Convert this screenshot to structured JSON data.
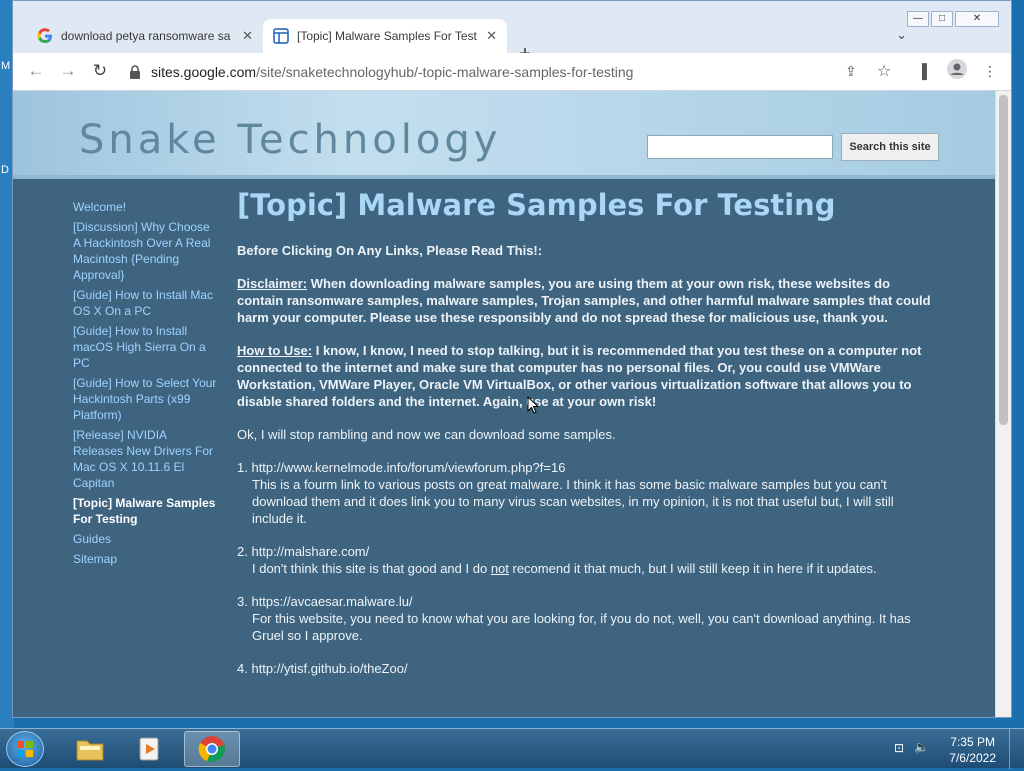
{
  "desktop": {
    "glyph1": "M",
    "glyph2": "D"
  },
  "browser": {
    "tabs": [
      {
        "title": "download petya ransomware sa",
        "favicon": "google-g-icon"
      },
      {
        "title": "[Topic] Malware Samples For Test",
        "favicon": "page-icon"
      }
    ],
    "new_tab": "+",
    "url_host": "sites.google.com",
    "url_path": "/site/snaketechnologyhub/-topic-malware-samples-for-testing",
    "window_controls": {
      "minimize": "—",
      "maximize": "□",
      "close": "✕"
    }
  },
  "site": {
    "title": "Snake Technology",
    "search_button": "Search this site",
    "search_value": "",
    "sidebar": [
      "Welcome!",
      "[Discussion] Why Choose A Hackintosh Over A Real Macintosh {Pending Approval}",
      "[Guide] How to Install Mac OS X On a PC",
      "[Guide] How to Install macOS High Sierra On a PC",
      "[Guide] How to Select Your Hackintosh Parts (x99 Platform)",
      "[Release] NVIDIA Releases New Drivers For Mac OS X 10.11.6 El Capitan",
      "[Topic] Malware Samples For Testing",
      "Guides",
      "Sitemap"
    ],
    "page": {
      "heading": "[Topic] Malware Samples For Testing",
      "intro": "Before Clicking On Any Links, Please Read This!:",
      "disclaimer_label": "Disclaimer:",
      "disclaimer_text": " When downloading malware samples, you are using them at your own risk, these websites do contain ransomware samples, malware samples, Trojan samples, and other harmful malware samples that could harm your computer. Please use these responsibly and do not spread these for malicious use, thank you.",
      "howto_label": "How to Use:",
      "howto_text": " I know, I know, I need to stop talking, but it is recommended that you test these on a computer not connected to the internet and make sure that computer has no personal files. Or, you could use VMWare Workstation, VMWare Player, Oracle VM VirtualBox, or other various virtualization software that allows you to disable shared folders and the internet. Again, use at your own risk!",
      "lead": "Ok, I will stop rambling and now we can download some samples.",
      "items": [
        {
          "num": "1. ",
          "link": "http://www.kernelmode.info/forum/viewforum.php?f=16",
          "desc": "This is a fourm link to various posts on great malware. I think it has some basic malware samples but you can't download them and it does link you to many virus scan websites, in my opinion, it is not that useful but, I will still include it."
        },
        {
          "num": "2. ",
          "link": "http://malshare.com/",
          "desc_pre": "I don't think this site is that good and I do ",
          "desc_u": "not",
          "desc_post": " recomend it that much, but I will still keep it in here if it updates."
        },
        {
          "num": "3. ",
          "link": "https://avcaesar.malware.lu/",
          "desc": "For this website, you need to know what you are looking for, if you do not, well, you can't download anything. It has Gruel so I approve."
        },
        {
          "num": "4. ",
          "link": "http://ytisf.github.io/theZoo/"
        }
      ]
    }
  },
  "taskbar": {
    "time": "7:35 PM",
    "date": "7/6/2022"
  }
}
